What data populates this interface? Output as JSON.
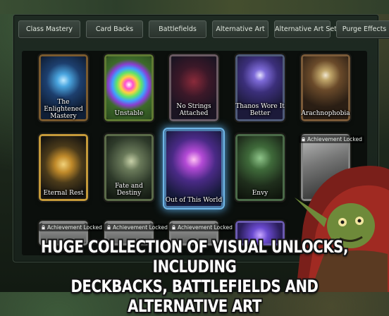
{
  "tabs": [
    {
      "label": "Class Mastery"
    },
    {
      "label": "Card Backs"
    },
    {
      "label": "Battlefields"
    },
    {
      "label": "Alternative Art"
    },
    {
      "label": "Alternative Art Setup"
    },
    {
      "label": "Purge Effects"
    }
  ],
  "cards": [
    {
      "name": "The Enlightened Mastery",
      "locked": false,
      "selected": false
    },
    {
      "name": "Unstable",
      "locked": false,
      "selected": false
    },
    {
      "name": "No Strings Attached",
      "locked": false,
      "selected": false
    },
    {
      "name": "Thanos Wore It Better",
      "locked": false,
      "selected": false
    },
    {
      "name": "Arachnophobia",
      "locked": false,
      "selected": false
    },
    {
      "name": "Eternal Rest",
      "locked": false,
      "selected": false
    },
    {
      "name": "Fate and Destiny",
      "locked": false,
      "selected": false
    },
    {
      "name": "Out of This World",
      "locked": false,
      "selected": true
    },
    {
      "name": "Envy",
      "locked": false,
      "selected": false
    },
    {
      "name": "",
      "locked": true,
      "selected": false
    }
  ],
  "locked_label": "Achievement Locked",
  "promo": {
    "line1": "HUGE COLLECTION OF VISUAL UNLOCKS, INCLUDING",
    "line2": "DECKBACKS, BATTLEFIELDS AND ALTERNATIVE ART"
  },
  "colors": {
    "accent_selected": "#6fb6e6",
    "card_frame_gold": "#b08a48",
    "tab_border": "#56615a"
  }
}
